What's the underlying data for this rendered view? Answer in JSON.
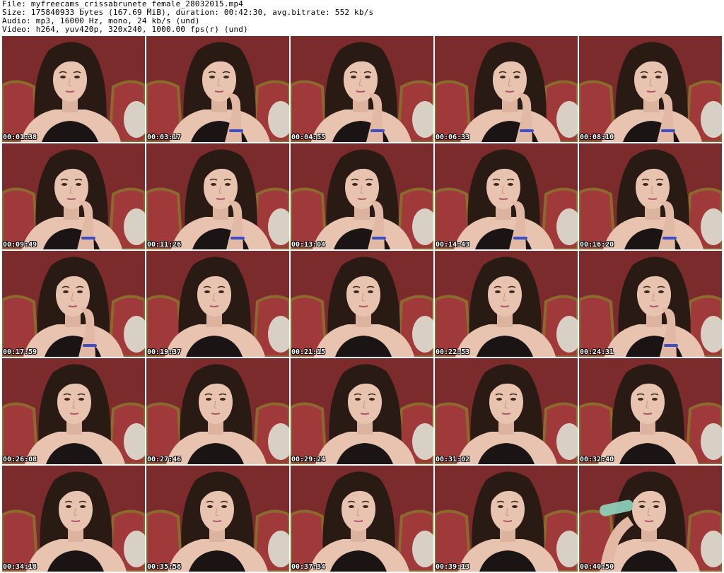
{
  "header": {
    "file_line": "File: myfreecams_crissabrunete_female_28032015.mp4",
    "size_line": "Size: 175840933 bytes (167.69 MiB), duration: 00:42:30, avg.bitrate: 552 kb/s",
    "audio_line": "Audio: mp3, 16000 Hz, mono, 24 kb/s (und)",
    "video_line": "Video: h264, yuv420p, 320x240, 1000.00 fps(r) (und)"
  },
  "frames": [
    {
      "timestamp": "00:01:38",
      "pose": "neutral"
    },
    {
      "timestamp": "00:03:17",
      "pose": "hand-chin"
    },
    {
      "timestamp": "00:04:55",
      "pose": "hand-chin"
    },
    {
      "timestamp": "00:06:33",
      "pose": "hand-chin"
    },
    {
      "timestamp": "00:08:10",
      "pose": "hand-chin"
    },
    {
      "timestamp": "00:09:49",
      "pose": "hand-chin"
    },
    {
      "timestamp": "00:11:26",
      "pose": "hand-chin"
    },
    {
      "timestamp": "00:13:04",
      "pose": "hand-chin"
    },
    {
      "timestamp": "00:14:43",
      "pose": "hand-chin"
    },
    {
      "timestamp": "00:16:20",
      "pose": "hand-chin"
    },
    {
      "timestamp": "00:17:59",
      "pose": "hand-chin"
    },
    {
      "timestamp": "00:19:37",
      "pose": "neutral"
    },
    {
      "timestamp": "00:21:15",
      "pose": "neutral"
    },
    {
      "timestamp": "00:22:53",
      "pose": "neutral"
    },
    {
      "timestamp": "00:24:31",
      "pose": "hand-chin"
    },
    {
      "timestamp": "00:26:08",
      "pose": "neutral"
    },
    {
      "timestamp": "00:27:46",
      "pose": "neutral"
    },
    {
      "timestamp": "00:29:24",
      "pose": "neutral"
    },
    {
      "timestamp": "00:31:02",
      "pose": "neutral"
    },
    {
      "timestamp": "00:32:40",
      "pose": "neutral"
    },
    {
      "timestamp": "00:34:18",
      "pose": "neutral"
    },
    {
      "timestamp": "00:35:56",
      "pose": "neutral"
    },
    {
      "timestamp": "00:37:34",
      "pose": "neutral"
    },
    {
      "timestamp": "00:39:13",
      "pose": "neutral"
    },
    {
      "timestamp": "00:40:50",
      "pose": "drinking"
    }
  ],
  "colors": {
    "wall": "#7b2b2c",
    "chair_wood": "#8c6a2e",
    "chair_fabric": "#a03a3a",
    "hair": "#2a1a14",
    "skin": "#e8c4b0",
    "clothing": "#1a1414",
    "bracelet": "#3c4ec8",
    "bottle": "#8fd6c0"
  }
}
